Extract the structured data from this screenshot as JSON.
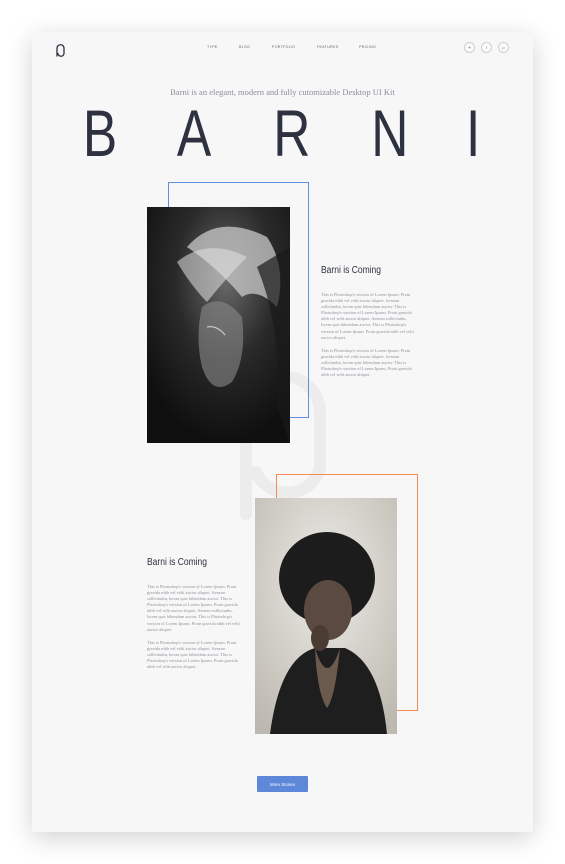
{
  "nav": {
    "items": [
      "Type",
      "Blog",
      "Portfolio",
      "Features",
      "Pricing"
    ]
  },
  "social": {
    "items": [
      {
        "icon": "twitter-icon",
        "glyph": "✦"
      },
      {
        "icon": "facebook-icon",
        "glyph": "f"
      },
      {
        "icon": "pinterest-icon",
        "glyph": "p"
      }
    ]
  },
  "hero": {
    "tagline": "Barni is an elegant, modern and fully cutomizable Desktop UI Kit",
    "letters": [
      "B",
      "A",
      "R",
      "N",
      "I"
    ]
  },
  "section1": {
    "title": "Barni is Coming",
    "paragraphs": [
      "This is Photoshop's version of Lorem Ipsum. Proin gravida nibh vel velit auctor aliquet. Aenean sollicitudin, lorem quis bibendum auctor. This is Photoshop's version of Lorem Ipsum. Proin gravida nibh vel velit auctor aliquet. Aenean sollicitudin, lorem quis bibendum auctor. This is Photoshop's version of Lorem Ipsum. Proin gravida nibh vel velit auctor aliquet.",
      "This is Photoshop's version of Lorem Ipsum. Proin gravida nibh vel velit auctor aliquet. Aenean sollicitudin, lorem quis bibendum auctor. This is Photoshop's version of Lorem Ipsum. Proin gravida nibh vel velit auctor aliquet."
    ]
  },
  "section2": {
    "title": "Barni is Coming",
    "paragraphs": [
      "This is Photoshop's version of Lorem Ipsum. Proin gravida nibh vel velit auctor aliquet. Aenean sollicitudin, lorem quis bibendum auctor. This is Photoshop's version of Lorem Ipsum. Proin gravida nibh vel velit auctor aliquet. Aenean sollicitudin, lorem quis bibendum auctor. This is Photoshop's version of Lorem Ipsum. Proin gravida nibh vel velit auctor aliquet.",
      "This is Photoshop's version of Lorem Ipsum. Proin gravida nibh vel velit auctor aliquet. Aenean sollicitudin, lorem quis bibendum auctor. This is Photoshop's version of Lorem Ipsum. Proin gravida nibh vel velit auctor aliquet."
    ]
  },
  "cta": {
    "label": "More Stories"
  },
  "colors": {
    "accent_blue": "#5d87d8",
    "accent_orange": "#ef8c5a",
    "text_dark": "#2d3140",
    "text_muted": "#8f939b"
  }
}
